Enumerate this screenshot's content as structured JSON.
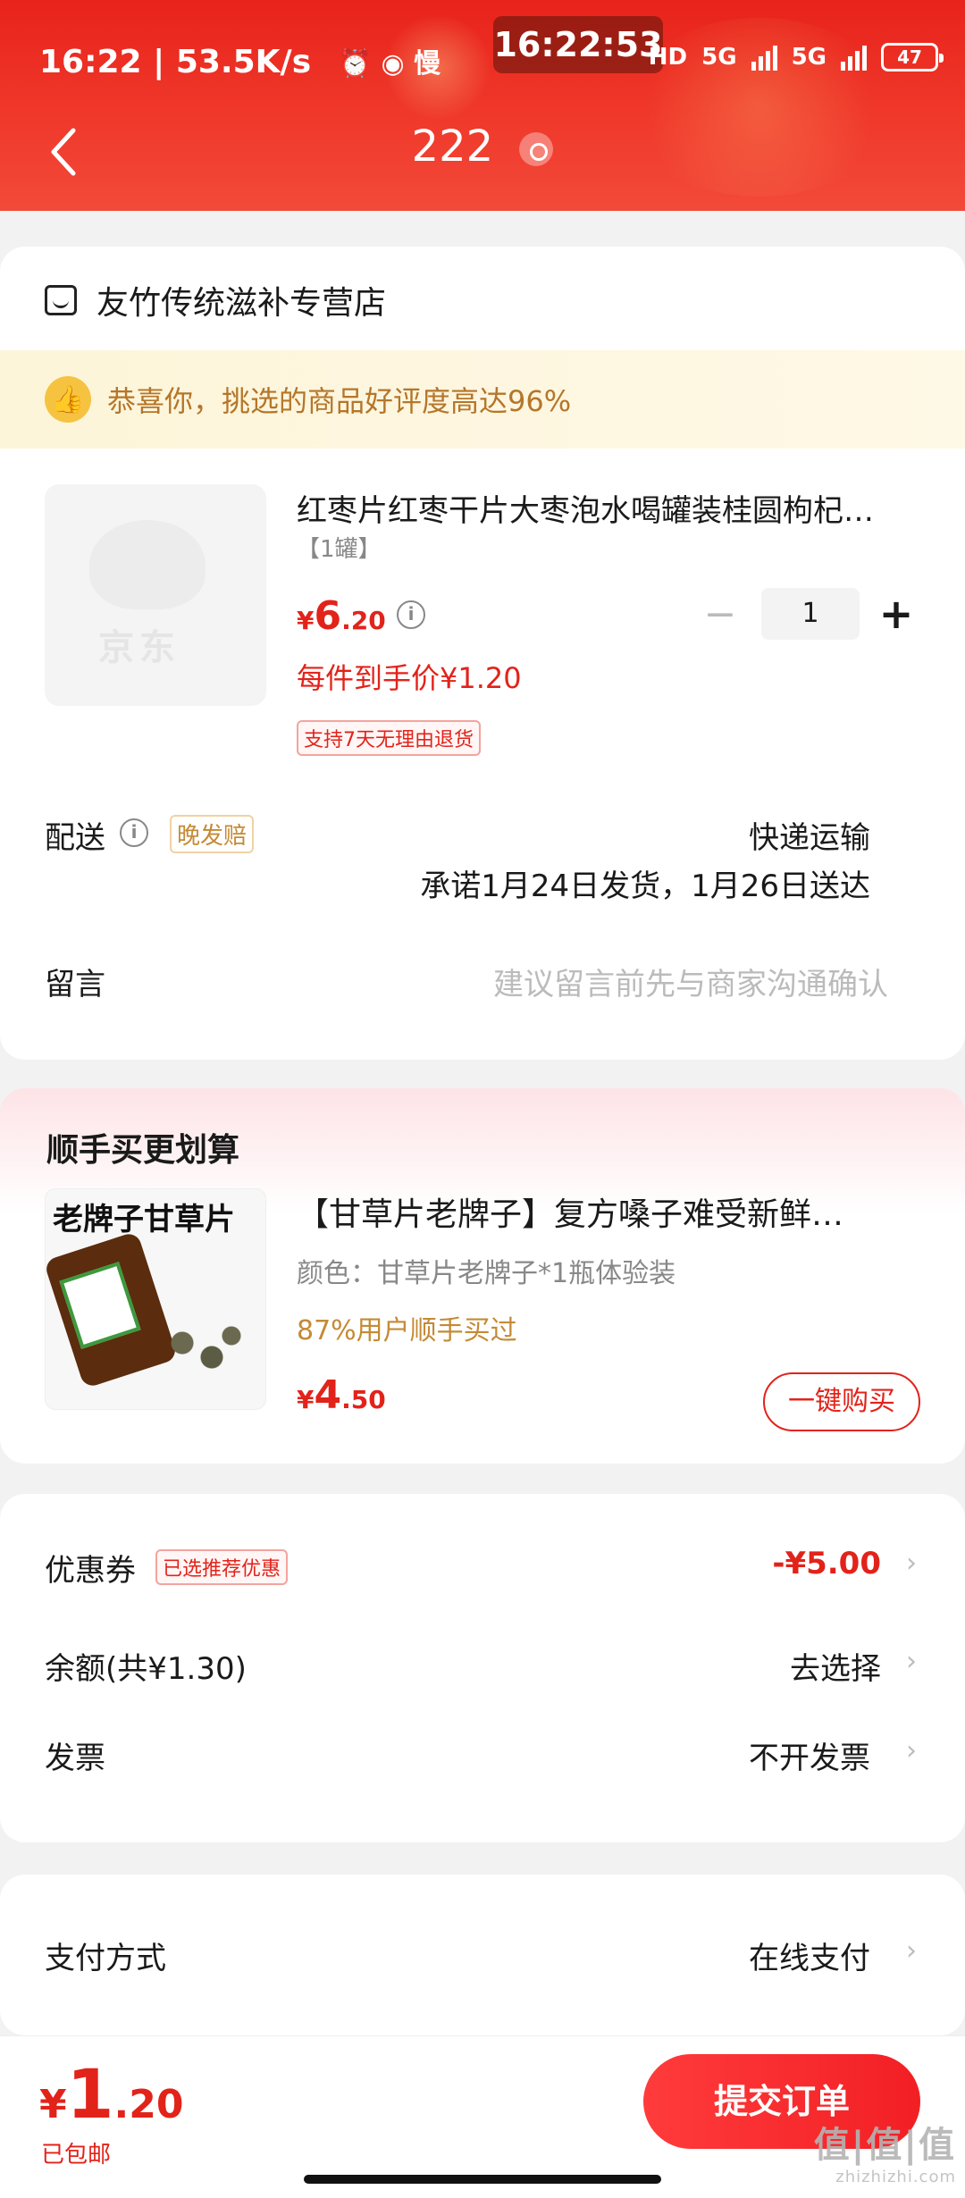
{
  "status_bar": {
    "time": "16:22",
    "speed": "53.5K/s",
    "extra": "慢",
    "clock_overlay": "16:22:53",
    "hd": "HD",
    "net1": "5G",
    "net2": "5G",
    "battery": "47"
  },
  "nav": {
    "address": "222",
    "back_icon": "chevron-left-icon",
    "location_icon": "location-pin-icon"
  },
  "shop": {
    "name": "友竹传统滋补专营店",
    "icon": "shop-icon"
  },
  "praise": {
    "text": "恭喜你，挑选的商品好评度高达96%",
    "icon": "thumbs-up-icon"
  },
  "product": {
    "image_logo": "京东",
    "title": "红枣片红枣干片大枣泡水喝罐装桂圆枸杞…",
    "spec": "【1罐】",
    "price_currency": "¥",
    "price_int": "6",
    "price_dec": ".20",
    "quantity": "1",
    "minus": "−",
    "plus": "+",
    "unit_price": "每件到手价¥1.20",
    "return_tag": "支持7天无理由退货"
  },
  "delivery": {
    "label": "配送",
    "late_tag": "晚发赔",
    "method": "快递运输",
    "promise": "承诺1月24日发货，1月26日送达"
  },
  "message": {
    "label": "留言",
    "placeholder": "建议留言前先与商家沟通确认"
  },
  "addon": {
    "section_title": "顺手买更划算",
    "image_text": "老牌子甘草片",
    "title": "【甘草片老牌子】复方嗓子难受新鲜…",
    "color": "颜色：甘草片老牌子*1瓶体验装",
    "bought": "87%用户顺手买过",
    "price_currency": "¥",
    "price_int": "4",
    "price_dec": ".50",
    "buy_label": "一键购买"
  },
  "discounts": {
    "coupon_label": "优惠券",
    "coupon_tag": "已选推荐优惠",
    "coupon_value": "-¥5.00",
    "balance_label": "余额(共¥1.30)",
    "balance_value": "去选择",
    "invoice_label": "发票",
    "invoice_value": "不开发票",
    "chevron": "›"
  },
  "payment": {
    "label": "支付方式",
    "value": "在线支付"
  },
  "bottom": {
    "total_currency": "¥",
    "total_int": "1",
    "total_dec": ".20",
    "shipping": "已包邮",
    "submit_label": "提交订单",
    "watermark": "值|值|值",
    "watermark_url": "zhizhizhi.com"
  },
  "colors": {
    "accent": "#e2231a",
    "header": "#f03a2c",
    "gold": "#c48a36"
  }
}
